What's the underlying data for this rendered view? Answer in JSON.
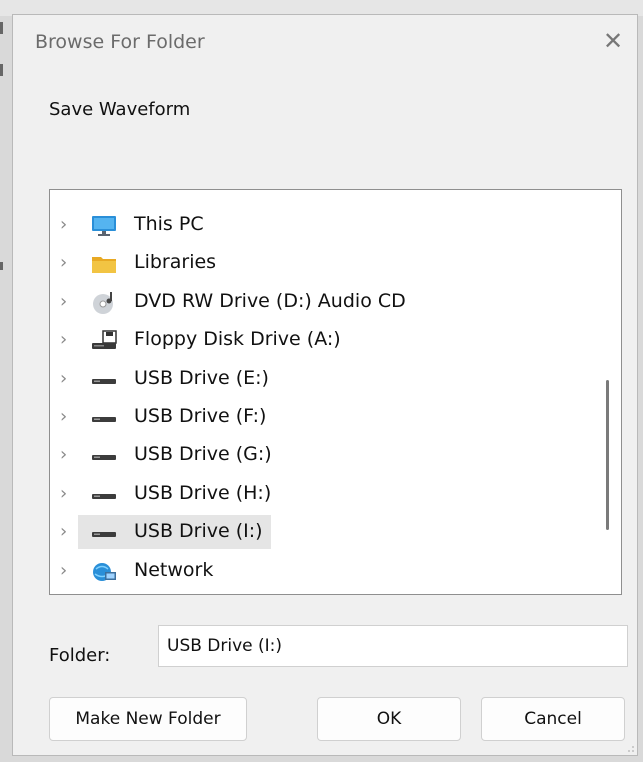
{
  "dialog": {
    "title": "Browse For Folder",
    "instruction": "Save Waveform",
    "tree": {
      "items": [
        {
          "label": "This PC",
          "icon": "monitor-icon",
          "name": "tree-item-this-pc"
        },
        {
          "label": "Libraries",
          "icon": "folder-icon",
          "name": "tree-item-libraries"
        },
        {
          "label": "DVD RW Drive (D:) Audio CD",
          "icon": "cd-drive-icon",
          "name": "tree-item-dvd-drive"
        },
        {
          "label": "Floppy Disk Drive (A:)",
          "icon": "floppy-drive-icon",
          "name": "tree-item-floppy-drive"
        },
        {
          "label": "USB Drive (E:)",
          "icon": "usb-drive-icon",
          "name": "tree-item-usb-e"
        },
        {
          "label": "USB Drive (F:)",
          "icon": "usb-drive-icon",
          "name": "tree-item-usb-f"
        },
        {
          "label": "USB Drive (G:)",
          "icon": "usb-drive-icon",
          "name": "tree-item-usb-g"
        },
        {
          "label": "USB Drive (H:)",
          "icon": "usb-drive-icon",
          "name": "tree-item-usb-h"
        },
        {
          "label": "USB Drive (I:)",
          "icon": "usb-drive-icon",
          "name": "tree-item-usb-i",
          "selected": true
        },
        {
          "label": "Network",
          "icon": "network-icon",
          "name": "tree-item-network"
        }
      ]
    },
    "folder": {
      "label": "Folder:",
      "value": "USB Drive (I:)"
    },
    "buttons": {
      "make_new_folder": "Make New Folder",
      "ok": "OK",
      "cancel": "Cancel"
    }
  },
  "colors": {
    "dialog_bg": "#f0f0f0",
    "selection_bg": "#e5e5e5",
    "monitor_blue": "#2a8fd8",
    "folder_yellow": "#f2c443"
  }
}
